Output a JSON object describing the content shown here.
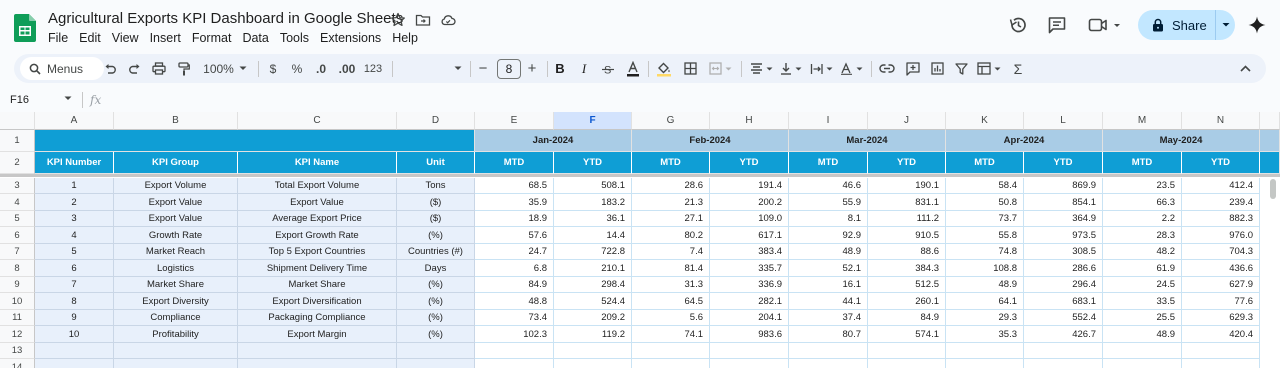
{
  "doc": {
    "title": "Agricultural Exports KPI Dashboard in Google Sheets",
    "menus": [
      "File",
      "Edit",
      "View",
      "Insert",
      "Format",
      "Data",
      "Tools",
      "Extensions",
      "Help"
    ]
  },
  "share": {
    "label": "Share"
  },
  "toolbar": {
    "menus_label": "Menus",
    "zoom": "100%",
    "currency": "$",
    "percent": "%",
    "dec_decrease": ".0",
    "dec_increase": ".00",
    "number_format": "123",
    "font_size": "8",
    "minus": "−",
    "plus": "+",
    "bold": "B",
    "italic": "I",
    "sigma": "Σ"
  },
  "formula_bar": {
    "cell_ref": "F16",
    "fx": "fx"
  },
  "grid": {
    "columns": [
      "A",
      "B",
      "C",
      "D",
      "E",
      "F",
      "G",
      "H",
      "I",
      "J",
      "K",
      "L",
      "M",
      "N"
    ],
    "selected_column": "F",
    "row_numbers": [
      "1",
      "2",
      "3",
      "4",
      "5",
      "6",
      "7",
      "8",
      "9",
      "10",
      "11",
      "12",
      "13",
      "14"
    ],
    "months": [
      "Jan-2024",
      "Feb-2024",
      "Mar-2024",
      "Apr-2024",
      "May-2024"
    ],
    "headers": [
      "KPI Number",
      "KPI Group",
      "KPI Name",
      "Unit"
    ],
    "mtd_label": "MTD",
    "ytd_label": "YTD",
    "rows": [
      {
        "num": "1",
        "group": "Export Volume",
        "name": "Total Export Volume",
        "unit": "Tons",
        "vals": [
          "68.5",
          "508.1",
          "28.6",
          "191.4",
          "46.6",
          "190.1",
          "58.4",
          "869.9",
          "23.5",
          "412.4"
        ]
      },
      {
        "num": "2",
        "group": "Export Value",
        "name": "Export Value",
        "unit": "($)",
        "vals": [
          "35.9",
          "183.2",
          "21.3",
          "200.2",
          "55.9",
          "831.1",
          "50.8",
          "854.1",
          "66.3",
          "239.4"
        ]
      },
      {
        "num": "3",
        "group": "Export Value",
        "name": "Average Export Price",
        "unit": "($)",
        "vals": [
          "18.9",
          "36.1",
          "27.1",
          "109.0",
          "8.1",
          "111.2",
          "73.7",
          "364.9",
          "2.2",
          "882.3"
        ]
      },
      {
        "num": "4",
        "group": "Growth Rate",
        "name": "Export Growth Rate",
        "unit": "(%)",
        "vals": [
          "57.6",
          "14.4",
          "80.2",
          "617.1",
          "92.9",
          "910.5",
          "55.8",
          "973.5",
          "28.3",
          "976.0"
        ]
      },
      {
        "num": "5",
        "group": "Market Reach",
        "name": "Top 5 Export Countries",
        "unit": "Countries (#)",
        "vals": [
          "24.7",
          "722.8",
          "7.4",
          "383.4",
          "48.9",
          "88.6",
          "74.8",
          "308.5",
          "48.2",
          "704.3"
        ]
      },
      {
        "num": "6",
        "group": "Logistics",
        "name": "Shipment Delivery Time",
        "unit": "Days",
        "vals": [
          "6.8",
          "210.1",
          "81.4",
          "335.7",
          "52.1",
          "384.3",
          "108.8",
          "286.6",
          "61.9",
          "436.6"
        ]
      },
      {
        "num": "7",
        "group": "Market Share",
        "name": "Market Share",
        "unit": "(%)",
        "vals": [
          "84.9",
          "298.4",
          "31.3",
          "336.9",
          "16.1",
          "512.5",
          "48.9",
          "296.4",
          "24.5",
          "627.9"
        ]
      },
      {
        "num": "8",
        "group": "Export Diversity",
        "name": "Export Diversification",
        "unit": "(%)",
        "vals": [
          "48.8",
          "524.4",
          "64.5",
          "282.1",
          "44.1",
          "260.1",
          "64.1",
          "683.1",
          "33.5",
          "77.6"
        ]
      },
      {
        "num": "9",
        "group": "Compliance",
        "name": "Packaging Compliance",
        "unit": "(%)",
        "vals": [
          "73.4",
          "209.2",
          "5.6",
          "204.1",
          "37.4",
          "84.9",
          "29.3",
          "552.4",
          "25.5",
          "629.3"
        ]
      },
      {
        "num": "10",
        "group": "Profitability",
        "name": "Export Margin",
        "unit": "(%)",
        "vals": [
          "102.3",
          "119.2",
          "74.1",
          "983.6",
          "80.7",
          "574.1",
          "35.3",
          "426.7",
          "48.9",
          "420.4"
        ]
      }
    ]
  },
  "colors": {
    "accent": "#0f9ed5",
    "month_band": "#a9cce6",
    "kpi_fill": "#e8f0fb",
    "share_bg": "#c2e7ff"
  }
}
